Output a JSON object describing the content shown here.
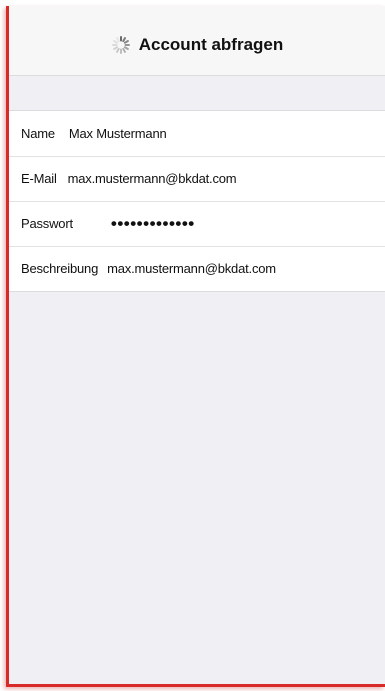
{
  "nav": {
    "title": "Account abfragen",
    "activity_icon": "spinner-icon"
  },
  "form": {
    "rows": [
      {
        "label": "Name",
        "value": "Max Mustermann"
      },
      {
        "label": "E-Mail",
        "value": "max.mustermann@bkdat.com"
      },
      {
        "label": "Passwort",
        "value": "•••••••••••••"
      },
      {
        "label": "Beschreibung",
        "value": "max.mustermann@bkdat.com"
      }
    ]
  },
  "colors": {
    "accent_border": "#d92a2a",
    "background": "#efeff4",
    "navbar": "#f7f7f7"
  }
}
